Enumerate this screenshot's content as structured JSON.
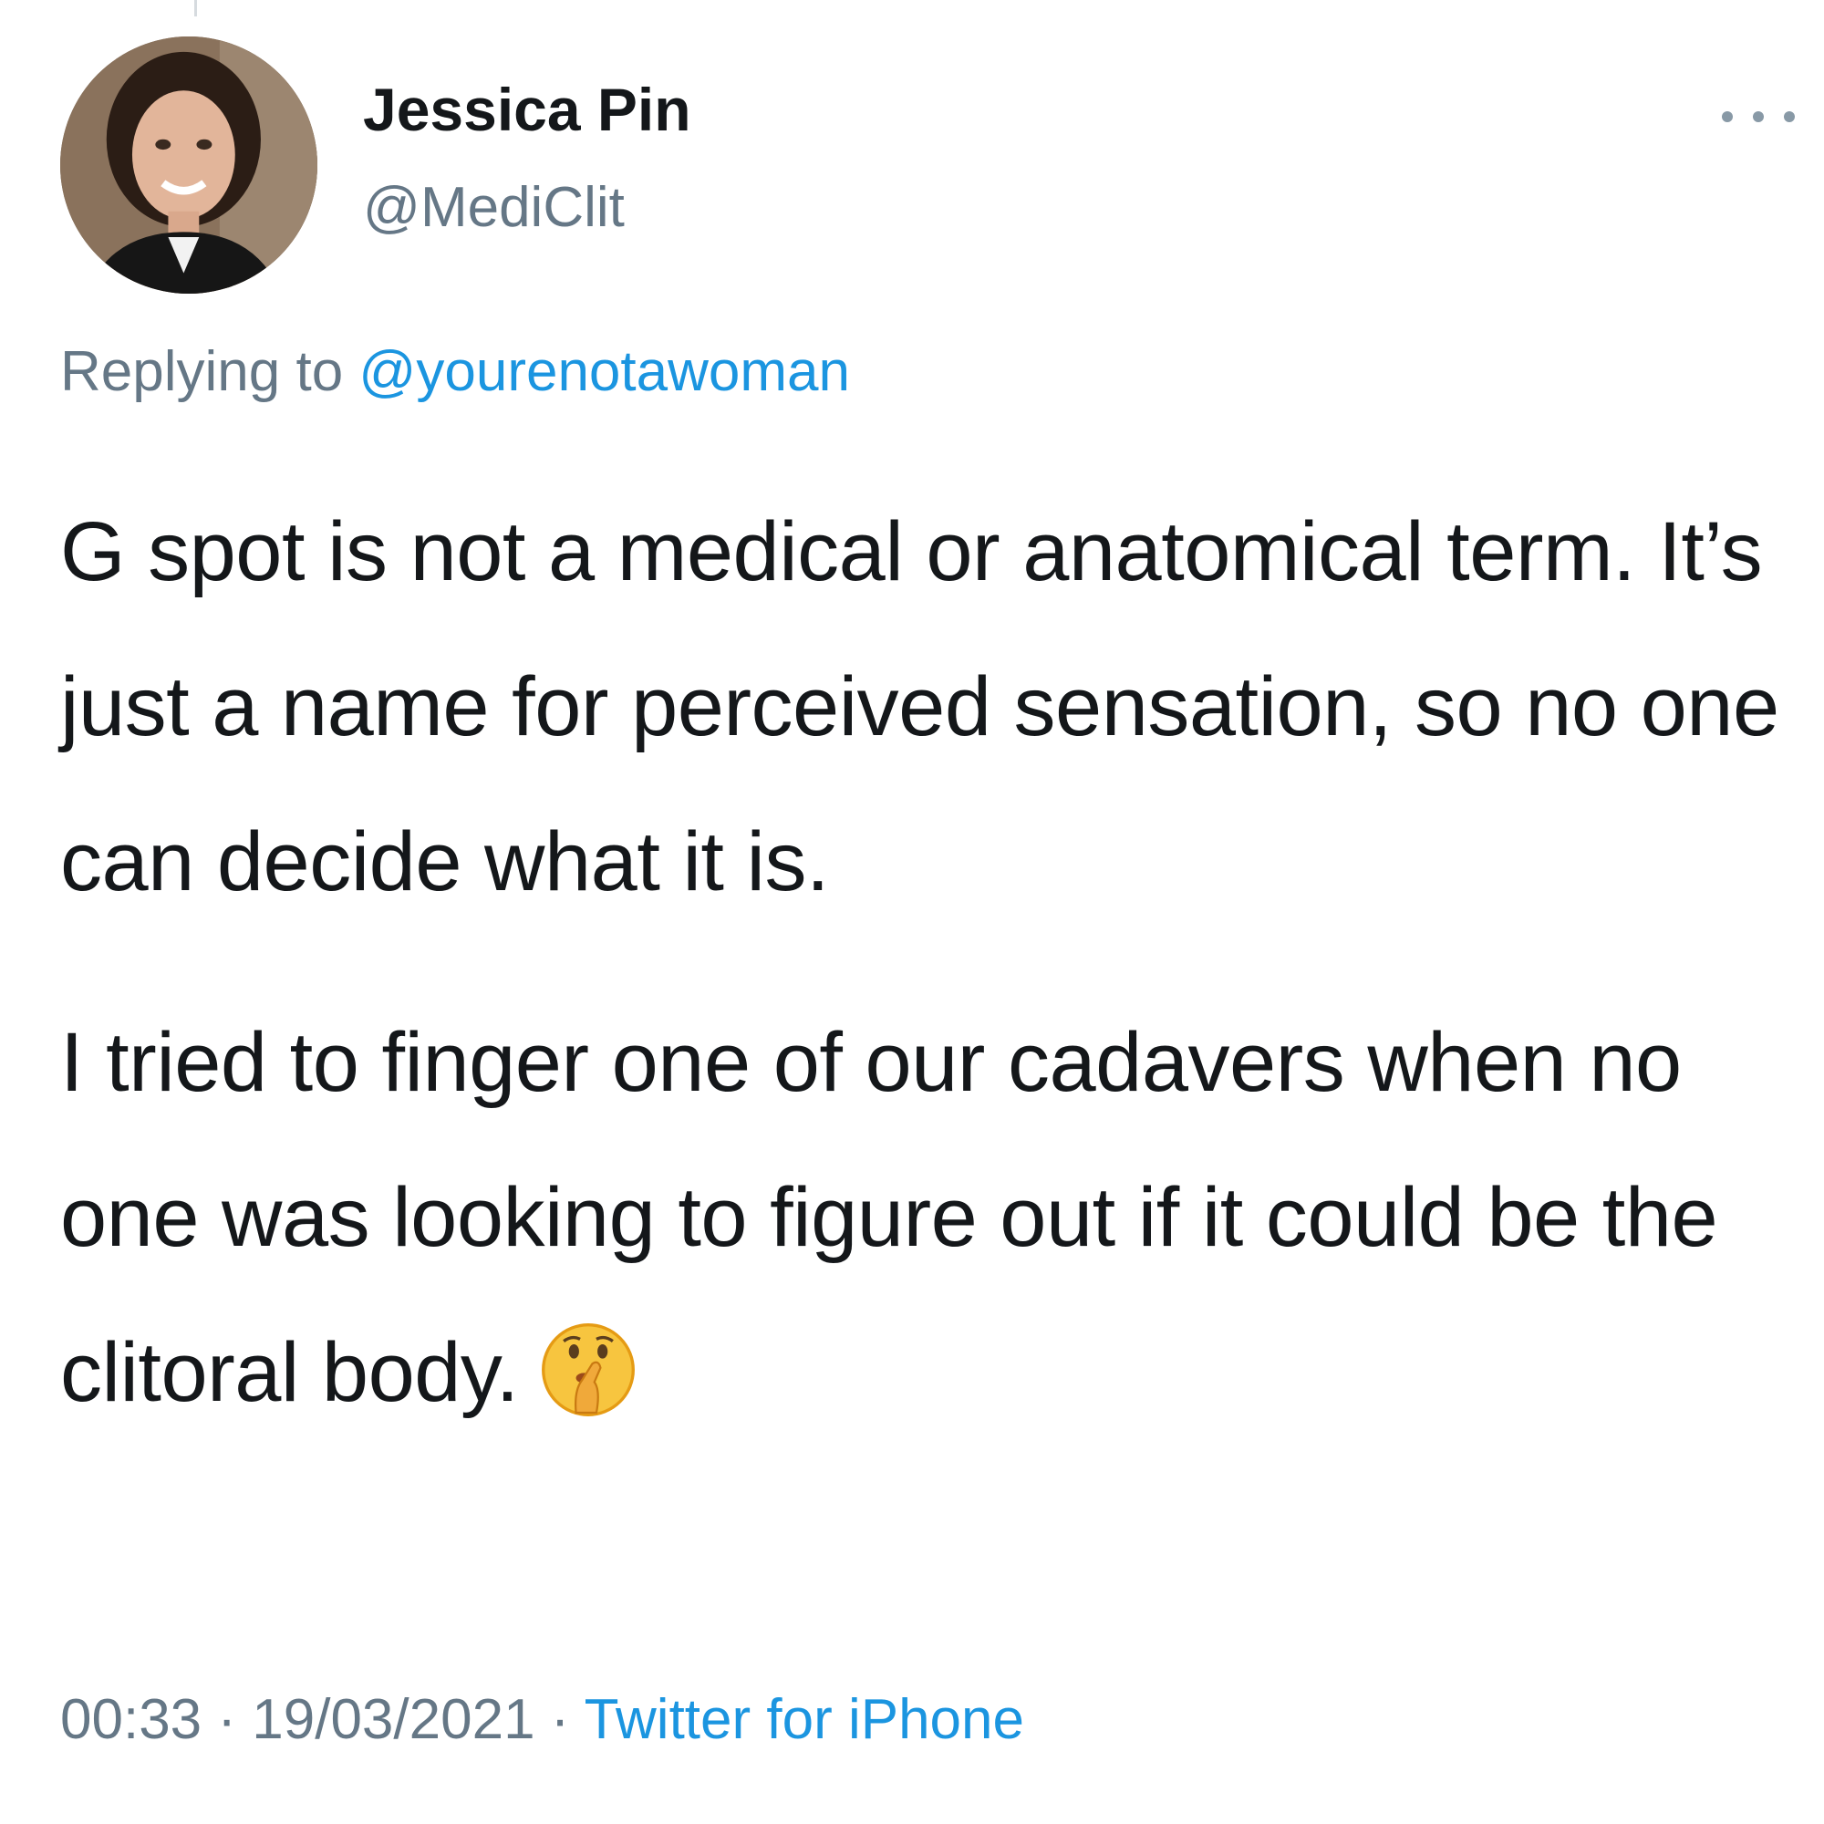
{
  "tweet": {
    "author": {
      "display_name": "Jessica Pin",
      "handle": "@MediClit",
      "avatar": "profile-photo"
    },
    "more_icon": "ellipsis-icon",
    "reply_context": {
      "prefix": "Replying to ",
      "mention": "@yourenotawoman"
    },
    "paragraphs": [
      "G spot is not a medical or anatomical term. It’s just a name for perceived sensation, so no one can decide what it is.",
      "I tried to finger one of our cadavers when no one was looking to figure out if it could be the clitoral body."
    ],
    "emoji": "shushing-face-icon",
    "time": "00:33",
    "separator": " · ",
    "date": "19/03/2021",
    "source": "Twitter for iPhone"
  },
  "colors": {
    "text": "#14171a",
    "secondary": "#657786",
    "link": "#1b95e0"
  }
}
